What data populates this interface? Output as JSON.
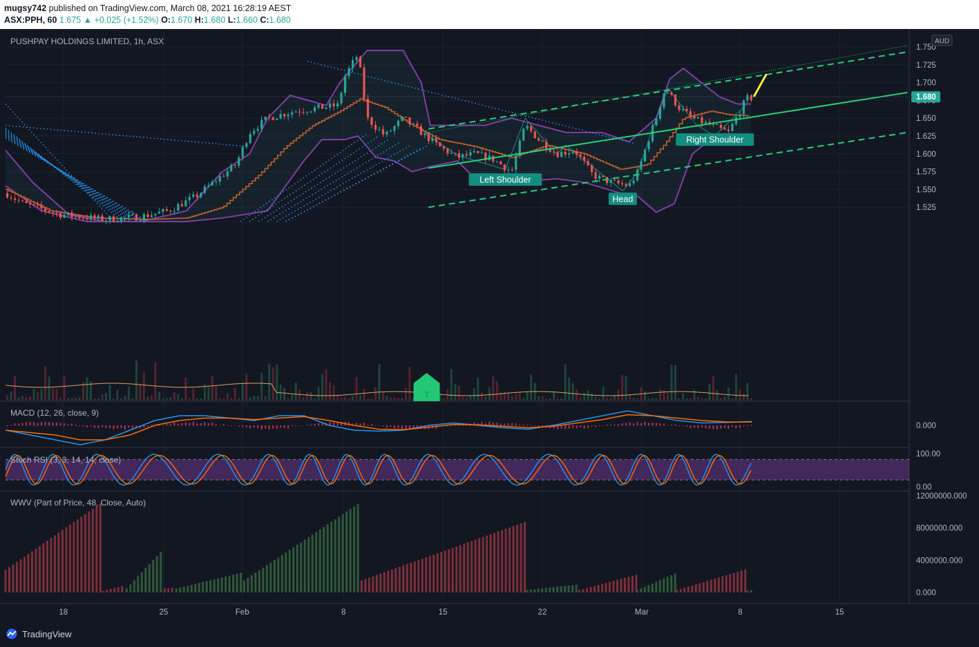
{
  "header": {
    "author": "mugsy742",
    "published_text": "published on TradingView.com, March 08, 2021 16:28:19 AEST",
    "symbol": "ASX:PPH, 60",
    "last": "1.675",
    "change": "+0.025 (+1.52%)",
    "o_label": "O:",
    "o": "1.670",
    "h_label": "H:",
    "h": "1.680",
    "l_label": "L:",
    "l": "1.660",
    "c_label": "C:",
    "c": "1.680"
  },
  "footer": {
    "brand": "TradingView"
  },
  "colors": {
    "bg": "#131722",
    "up": "#26a69a",
    "down": "#ef5350",
    "bollinger": "#7e3fa3",
    "step": "#c55f2c",
    "channel": "#22d37a",
    "dotted": "#2196f3",
    "macd": "#2196f3",
    "signal": "#ff6d00",
    "yellow": "#ffeb3b",
    "wwv_up": "#2e5a3a",
    "wwv_down": "#7d2f3a"
  },
  "chart_data": [
    {
      "type": "candlestick",
      "title": "PUSHPAY HOLDINGS LIMITED, 1h, ASX",
      "currency_badge": "AUD",
      "last_price_label": "1.680",
      "y_ticks": [
        "1.750",
        "1.725",
        "1.700",
        "1.675",
        "1.650",
        "1.625",
        "1.600",
        "1.575",
        "1.550",
        "1.525"
      ],
      "ylim": [
        1.505,
        1.755
      ],
      "x_ticks": [
        {
          "label": "18",
          "t": 0.064
        },
        {
          "label": "25",
          "t": 0.175
        },
        {
          "label": "Feb",
          "t": 0.262
        },
        {
          "label": "8",
          "t": 0.374
        },
        {
          "label": "15",
          "t": 0.484
        },
        {
          "label": "22",
          "t": 0.594
        },
        {
          "label": "Mar",
          "t": 0.704
        },
        {
          "label": "8",
          "t": 0.813
        },
        {
          "label": "15",
          "t": 0.923
        }
      ],
      "price_path": [
        {
          "t": 0.0,
          "p": 1.545
        },
        {
          "t": 0.02,
          "p": 1.53
        },
        {
          "t": 0.06,
          "p": 1.515
        },
        {
          "t": 0.11,
          "p": 1.508
        },
        {
          "t": 0.15,
          "p": 1.512
        },
        {
          "t": 0.18,
          "p": 1.52
        },
        {
          "t": 0.21,
          "p": 1.54
        },
        {
          "t": 0.23,
          "p": 1.56
        },
        {
          "t": 0.255,
          "p": 1.585
        },
        {
          "t": 0.27,
          "p": 1.63
        },
        {
          "t": 0.29,
          "p": 1.65
        },
        {
          "t": 0.32,
          "p": 1.66
        },
        {
          "t": 0.35,
          "p": 1.665
        },
        {
          "t": 0.368,
          "p": 1.668
        },
        {
          "t": 0.376,
          "p": 1.71
        },
        {
          "t": 0.39,
          "p": 1.74
        },
        {
          "t": 0.4,
          "p": 1.65
        },
        {
          "t": 0.42,
          "p": 1.625
        },
        {
          "t": 0.44,
          "p": 1.65
        },
        {
          "t": 0.46,
          "p": 1.63
        },
        {
          "t": 0.48,
          "p": 1.61
        },
        {
          "t": 0.5,
          "p": 1.595
        },
        {
          "t": 0.52,
          "p": 1.6
        },
        {
          "t": 0.54,
          "p": 1.592
        },
        {
          "t": 0.56,
          "p": 1.575
        },
        {
          "t": 0.575,
          "p": 1.64
        },
        {
          "t": 0.59,
          "p": 1.62
        },
        {
          "t": 0.61,
          "p": 1.6
        },
        {
          "t": 0.63,
          "p": 1.605
        },
        {
          "t": 0.65,
          "p": 1.57
        },
        {
          "t": 0.67,
          "p": 1.56
        },
        {
          "t": 0.69,
          "p": 1.555
        },
        {
          "t": 0.7,
          "p": 1.575
        },
        {
          "t": 0.71,
          "p": 1.615
        },
        {
          "t": 0.72,
          "p": 1.65
        },
        {
          "t": 0.73,
          "p": 1.692
        },
        {
          "t": 0.745,
          "p": 1.665
        },
        {
          "t": 0.76,
          "p": 1.65
        },
        {
          "t": 0.78,
          "p": 1.64
        },
        {
          "t": 0.8,
          "p": 1.63
        },
        {
          "t": 0.82,
          "p": 1.678
        }
      ],
      "series": [
        {
          "name": "Bollinger upper",
          "style": "line",
          "points": [
            {
              "t": 0.0,
              "p": 1.555
            },
            {
              "t": 0.04,
              "p": 1.52
            },
            {
              "t": 0.09,
              "p": 1.505
            },
            {
              "t": 0.15,
              "p": 1.505
            },
            {
              "t": 0.2,
              "p": 1.52
            },
            {
              "t": 0.24,
              "p": 1.575
            },
            {
              "t": 0.27,
              "p": 1.6
            },
            {
              "t": 0.29,
              "p": 1.65
            },
            {
              "t": 0.315,
              "p": 1.682
            },
            {
              "t": 0.335,
              "p": 1.675
            },
            {
              "t": 0.355,
              "p": 1.668
            },
            {
              "t": 0.37,
              "p": 1.7
            },
            {
              "t": 0.4,
              "p": 1.745
            },
            {
              "t": 0.44,
              "p": 1.745
            },
            {
              "t": 0.46,
              "p": 1.7
            },
            {
              "t": 0.47,
              "p": 1.64
            },
            {
              "t": 0.5,
              "p": 1.64
            },
            {
              "t": 0.53,
              "p": 1.64
            },
            {
              "t": 0.56,
              "p": 1.65
            },
            {
              "t": 0.59,
              "p": 1.64
            },
            {
              "t": 0.62,
              "p": 1.63
            },
            {
              "t": 0.66,
              "p": 1.63
            },
            {
              "t": 0.69,
              "p": 1.617
            },
            {
              "t": 0.72,
              "p": 1.65
            },
            {
              "t": 0.735,
              "p": 1.705
            },
            {
              "t": 0.75,
              "p": 1.72
            },
            {
              "t": 0.77,
              "p": 1.7
            },
            {
              "t": 0.79,
              "p": 1.68
            },
            {
              "t": 0.81,
              "p": 1.67
            },
            {
              "t": 0.825,
              "p": 1.67
            }
          ]
        },
        {
          "name": "Bollinger lower",
          "style": "line",
          "points": [
            {
              "t": 0.0,
              "p": 1.605
            },
            {
              "t": 0.03,
              "p": 1.56
            },
            {
              "t": 0.07,
              "p": 1.515
            },
            {
              "t": 0.11,
              "p": 1.505
            },
            {
              "t": 0.16,
              "p": 1.505
            },
            {
              "t": 0.2,
              "p": 1.505
            },
            {
              "t": 0.24,
              "p": 1.51
            },
            {
              "t": 0.29,
              "p": 1.52
            },
            {
              "t": 0.33,
              "p": 1.59
            },
            {
              "t": 0.35,
              "p": 1.62
            },
            {
              "t": 0.375,
              "p": 1.62
            },
            {
              "t": 0.39,
              "p": 1.625
            },
            {
              "t": 0.41,
              "p": 1.595
            },
            {
              "t": 0.43,
              "p": 1.59
            },
            {
              "t": 0.45,
              "p": 1.575
            },
            {
              "t": 0.47,
              "p": 1.582
            },
            {
              "t": 0.5,
              "p": 1.59
            },
            {
              "t": 0.52,
              "p": 1.565
            },
            {
              "t": 0.55,
              "p": 1.56
            },
            {
              "t": 0.58,
              "p": 1.562
            },
            {
              "t": 0.61,
              "p": 1.565
            },
            {
              "t": 0.64,
              "p": 1.56
            },
            {
              "t": 0.68,
              "p": 1.545
            },
            {
              "t": 0.7,
              "p": 1.54
            },
            {
              "t": 0.72,
              "p": 1.518
            },
            {
              "t": 0.74,
              "p": 1.53
            },
            {
              "t": 0.76,
              "p": 1.6
            },
            {
              "t": 0.78,
              "p": 1.62
            },
            {
              "t": 0.8,
              "p": 1.628
            },
            {
              "t": 0.825,
              "p": 1.627
            }
          ]
        },
        {
          "name": "Basis step",
          "style": "step",
          "points": [
            {
              "t": 0.0,
              "p": 1.55
            },
            {
              "t": 0.05,
              "p": 1.52
            },
            {
              "t": 0.1,
              "p": 1.51
            },
            {
              "t": 0.16,
              "p": 1.508
            },
            {
              "t": 0.2,
              "p": 1.51
            },
            {
              "t": 0.24,
              "p": 1.525
            },
            {
              "t": 0.28,
              "p": 1.57
            },
            {
              "t": 0.31,
              "p": 1.61
            },
            {
              "t": 0.34,
              "p": 1.64
            },
            {
              "t": 0.37,
              "p": 1.66
            },
            {
              "t": 0.392,
              "p": 1.677
            },
            {
              "t": 0.42,
              "p": 1.665
            },
            {
              "t": 0.45,
              "p": 1.64
            },
            {
              "t": 0.48,
              "p": 1.62
            },
            {
              "t": 0.52,
              "p": 1.61
            },
            {
              "t": 0.56,
              "p": 1.595
            },
            {
              "t": 0.6,
              "p": 1.612
            },
            {
              "t": 0.64,
              "p": 1.6
            },
            {
              "t": 0.68,
              "p": 1.578
            },
            {
              "t": 0.71,
              "p": 1.585
            },
            {
              "t": 0.73,
              "p": 1.615
            },
            {
              "t": 0.75,
              "p": 1.65
            },
            {
              "t": 0.78,
              "p": 1.66
            },
            {
              "t": 0.8,
              "p": 1.655
            },
            {
              "t": 0.825,
              "p": 1.653
            }
          ]
        },
        {
          "name": "Channel middle",
          "style": "solid",
          "points": [
            {
              "t": 0.468,
              "p": 1.58
            },
            {
              "t": 0.998,
              "p": 1.686
            }
          ]
        },
        {
          "name": "Channel upper",
          "style": "dashed",
          "points": [
            {
              "t": 0.468,
              "p": 1.635
            },
            {
              "t": 0.998,
              "p": 1.743
            }
          ]
        },
        {
          "name": "Channel lower",
          "style": "dashed",
          "points": [
            {
              "t": 0.468,
              "p": 1.525
            },
            {
              "t": 0.998,
              "p": 1.63
            }
          ]
        },
        {
          "name": "Median dotted",
          "style": "dotted",
          "points": [
            {
              "t": 0.468,
              "p": 1.63
            },
            {
              "t": 0.998,
              "p": 1.752
            }
          ]
        },
        {
          "name": "Projection",
          "style": "yellow",
          "points": [
            {
              "t": 0.828,
              "p": 1.68
            },
            {
              "t": 0.842,
              "p": 1.712
            }
          ]
        }
      ],
      "annotations": [
        {
          "label": "Left Shoulder",
          "t": 0.553,
          "p": 1.564
        },
        {
          "label": "Head",
          "t": 0.683,
          "p": 1.537
        },
        {
          "label": "Right Shoulder",
          "t": 0.785,
          "p": 1.62
        }
      ],
      "marker": {
        "label": "⇧",
        "t": 0.466
      }
    },
    {
      "type": "line",
      "title": "MACD (12, 26, close, 9)",
      "y_ticks": [
        "0.000"
      ],
      "series": [
        {
          "name": "MACD",
          "values": [
            -0.01,
            -0.02,
            -0.03,
            -0.04,
            -0.03,
            -0.01,
            0.01,
            0.02,
            0.02,
            0.015,
            0.01,
            0.02,
            0.02,
            0.0,
            -0.01,
            -0.012,
            -0.01,
            0.0,
            0.005,
            0.0,
            -0.005,
            -0.008,
            0.0,
            0.01,
            0.02,
            0.03,
            0.02,
            0.01,
            0.005,
            0.006,
            0.008
          ]
        },
        {
          "name": "Signal",
          "values": [
            -0.01,
            -0.015,
            -0.02,
            -0.03,
            -0.03,
            -0.02,
            0.0,
            0.01,
            0.015,
            0.015,
            0.012,
            0.015,
            0.018,
            0.01,
            0.0,
            -0.008,
            -0.009,
            -0.004,
            0.002,
            0.001,
            -0.002,
            -0.005,
            -0.002,
            0.005,
            0.012,
            0.022,
            0.02,
            0.015,
            0.01,
            0.007,
            0.007
          ]
        }
      ]
    },
    {
      "type": "line",
      "title": "Stoch RSI (3, 3, 14, 14, close)",
      "y_ticks": [
        "100.00",
        "0.00"
      ],
      "ylim": [
        0,
        100
      ]
    },
    {
      "type": "bar",
      "title": "WWV (Part of Price, 48, Close, Auto)",
      "y_ticks": [
        "12000000.000",
        "8000000.000",
        "4000000.000",
        "0.000"
      ],
      "ylim": [
        0,
        12800000
      ],
      "segments": [
        {
          "t0": 0.0,
          "t1": 0.107,
          "from": 2800000,
          "to": 11200000,
          "dir": "down"
        },
        {
          "t0": 0.108,
          "t1": 0.133,
          "from": 200000,
          "to": 900000,
          "dir": "down"
        },
        {
          "t0": 0.134,
          "t1": 0.175,
          "from": 500000,
          "to": 5400000,
          "dir": "up"
        },
        {
          "t0": 0.176,
          "t1": 0.188,
          "from": 500000,
          "to": 600000,
          "dir": "down"
        },
        {
          "t0": 0.189,
          "t1": 0.263,
          "from": 500000,
          "to": 2500000,
          "dir": "up"
        },
        {
          "t0": 0.264,
          "t1": 0.393,
          "from": 1500000,
          "to": 11200000,
          "dir": "up"
        },
        {
          "t0": 0.394,
          "t1": 0.576,
          "from": 1500000,
          "to": 8800000,
          "dir": "down"
        },
        {
          "t0": 0.577,
          "t1": 0.634,
          "from": 300000,
          "to": 1000000,
          "dir": "up"
        },
        {
          "t0": 0.635,
          "t1": 0.698,
          "from": 300000,
          "to": 2200000,
          "dir": "down"
        },
        {
          "t0": 0.699,
          "t1": 0.742,
          "from": 300000,
          "to": 2400000,
          "dir": "up"
        },
        {
          "t0": 0.743,
          "t1": 0.82,
          "from": 300000,
          "to": 2900000,
          "dir": "down"
        },
        {
          "t0": 0.821,
          "t1": 0.828,
          "from": 200000,
          "to": 300000,
          "dir": "up"
        }
      ]
    }
  ]
}
